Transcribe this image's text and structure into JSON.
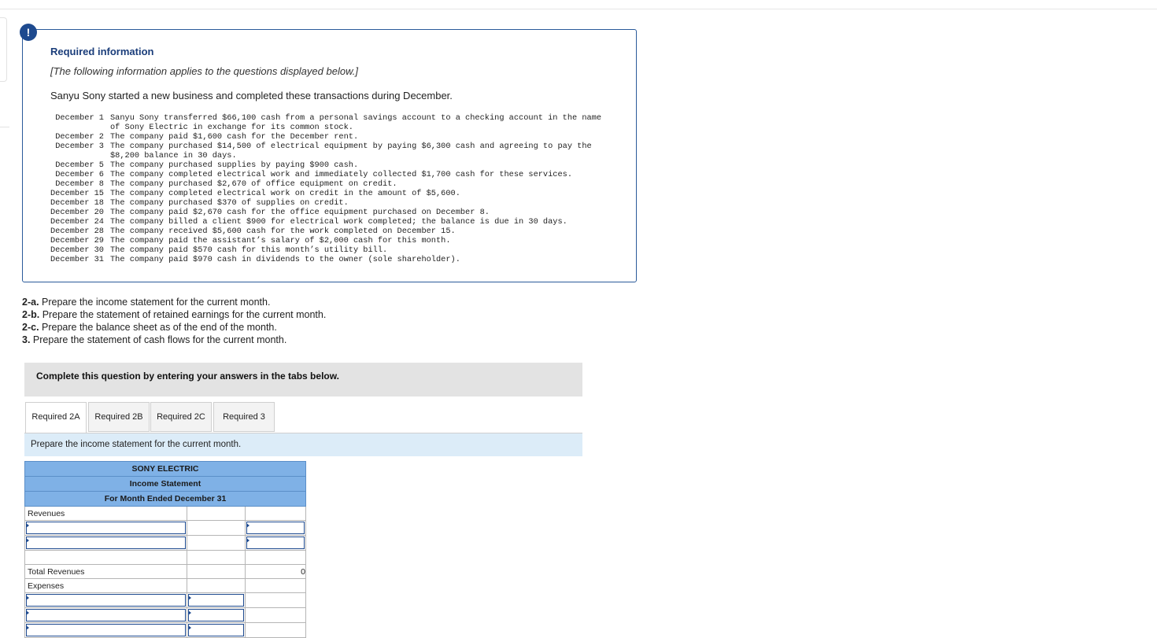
{
  "alert": {
    "symbol": "!"
  },
  "info": {
    "title": "Required information",
    "subtitle": "[The following information applies to the questions displayed below.]",
    "intro": "Sanyu Sony started a new business and completed these transactions during December.",
    "transactions": [
      {
        "date": "December 1",
        "text": "Sanyu Sony transferred $66,100 cash from a personal savings account to a checking account in the name of Sony Electric in exchange for its common stock."
      },
      {
        "date": "December 2",
        "text": "The company paid $1,600 cash for the December rent."
      },
      {
        "date": "December 3",
        "text": "The company purchased $14,500 of electrical equipment by paying $6,300 cash and agreeing to pay the $8,200 balance in 30 days."
      },
      {
        "date": "December 5",
        "text": "The company purchased supplies by paying $900 cash."
      },
      {
        "date": "December 6",
        "text": "The company completed electrical work and immediately collected $1,700 cash for these services."
      },
      {
        "date": "December 8",
        "text": "The company purchased $2,670 of office equipment on credit."
      },
      {
        "date": "December 15",
        "text": "The company completed electrical work on credit in the amount of $5,600."
      },
      {
        "date": "December 18",
        "text": "The company purchased $370 of supplies on credit."
      },
      {
        "date": "December 20",
        "text": "The company paid $2,670 cash for the office equipment purchased on December 8."
      },
      {
        "date": "December 24",
        "text": "The company billed a client $900 for electrical work completed; the balance is due in 30 days."
      },
      {
        "date": "December 28",
        "text": "The company received $5,600 cash for the work completed on December 15."
      },
      {
        "date": "December 29",
        "text": "The company paid the assistant’s salary of $2,000 cash for this month."
      },
      {
        "date": "December 30",
        "text": "The company paid $570 cash for this month’s utility bill."
      },
      {
        "date": "December 31",
        "text": "The company paid $970 cash in dividends to the owner (sole shareholder)."
      }
    ]
  },
  "requirements": [
    {
      "label": "2-a.",
      "text": " Prepare the income statement for the current month."
    },
    {
      "label": "2-b.",
      "text": " Prepare the statement of retained earnings for the current month."
    },
    {
      "label": "2-c.",
      "text": " Prepare the balance sheet as of the end of the month."
    },
    {
      "label": "3.",
      "text": " Prepare the statement of cash flows for the current month."
    }
  ],
  "complete_bar": "Complete this question by entering your answers in the tabs below.",
  "tabs": [
    "Required 2A",
    "Required 2B",
    "Required 2C",
    "Required 3"
  ],
  "prompt": "Prepare the income statement for the current month.",
  "statement": {
    "company": "SONY ELECTRIC",
    "name": "Income Statement",
    "period": "For Month Ended December 31",
    "revenues_label": "Revenues",
    "total_revenues_label": "Total Revenues",
    "total_revenues_value": "0",
    "expenses_label": "Expenses"
  }
}
